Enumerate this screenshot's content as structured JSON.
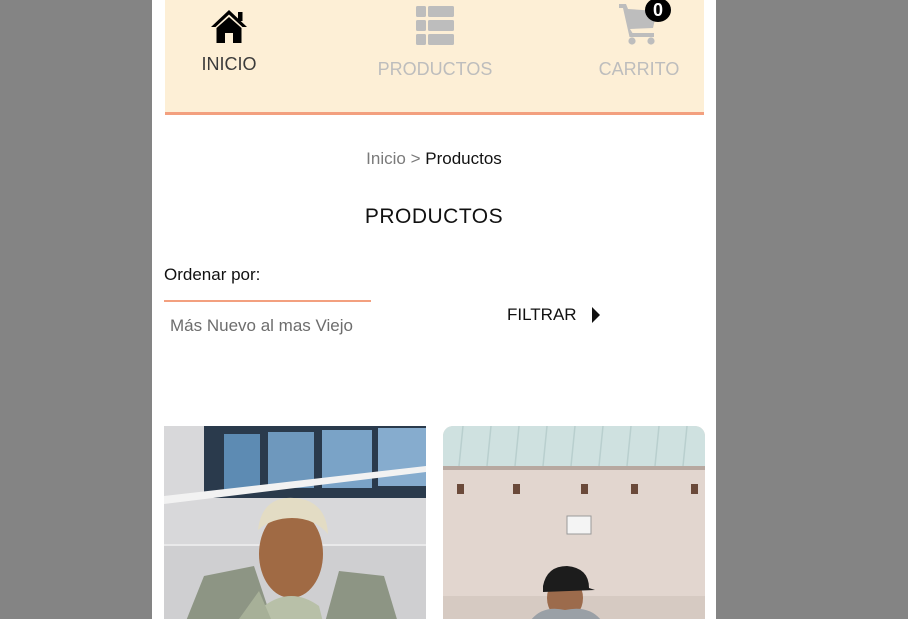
{
  "nav": {
    "items": [
      {
        "label": "INICIO",
        "icon": "home-icon",
        "active": true
      },
      {
        "label": "PRODUCTOS",
        "icon": "grid-list-icon",
        "active": false
      },
      {
        "label": "CARRITO",
        "icon": "shopping-cart-icon",
        "active": false
      }
    ],
    "cart_count": "0",
    "accent_color": "#f3a07f",
    "background_color": "#fdefd6"
  },
  "breadcrumb": {
    "home": "Inicio",
    "separator": ">",
    "current": "Productos"
  },
  "page": {
    "title": "PRODUCTOS"
  },
  "sort": {
    "label": "Ordenar por:",
    "selected": "Más Nuevo al mas Viejo"
  },
  "filter": {
    "label": "FILTRAR",
    "icon": "caret-right-icon"
  },
  "products": [
    {
      "image": "product-photo"
    },
    {
      "image": "product-photo"
    }
  ]
}
